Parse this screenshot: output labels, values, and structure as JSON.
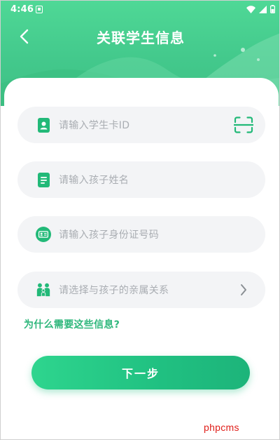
{
  "status_bar": {
    "time": "4:46"
  },
  "nav": {
    "title": "关联学生信息"
  },
  "form": {
    "student_card_placeholder": "请输入学生卡ID",
    "child_name_placeholder": "请输入孩子姓名",
    "child_id_placeholder": "请输入孩子身份证号码",
    "relation_placeholder": "请选择与孩子的亲属关系",
    "why_link": "为什么需要这些信息?",
    "next_button": "下一步"
  },
  "watermark": "phpcms",
  "icons": {
    "back": "chevron-left-icon",
    "student_card": "id-badge-icon",
    "child_name": "document-icon",
    "child_id": "id-card-icon",
    "relation": "family-icon",
    "scan": "scan-icon",
    "relation_arrow": "chevron-right-icon"
  },
  "colors": {
    "header_green": "#43c98c",
    "accent_green": "#2fb77c",
    "button_green": "#20c081",
    "field_bg": "#f3f4f6",
    "placeholder": "#a9adb2",
    "watermark_red": "#e0201b"
  }
}
